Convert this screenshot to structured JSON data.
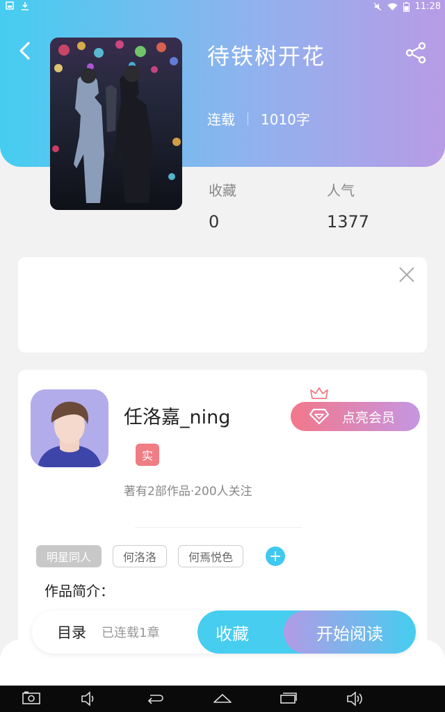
{
  "status_bar": {
    "time": "11:28"
  },
  "book": {
    "title": "待铁树开花",
    "status": "连载",
    "word_count": "1010字"
  },
  "stats": {
    "favorites_label": "收藏",
    "favorites_value": "0",
    "popularity_label": "人气",
    "popularity_value": "1377"
  },
  "author": {
    "name": "任洛嘉_ning",
    "real_badge": "实",
    "info": "著有2部作品·200人关注",
    "vip_label": "点亮会员"
  },
  "tags": [
    "明星同人",
    "何洛洛",
    "何焉悦色"
  ],
  "tag_add": "+",
  "intro_label": "作品简介：",
  "action_bar": {
    "toc_label": "目录",
    "toc_status": "已连载1章",
    "favorite_label": "收藏",
    "read_label": "开始阅读"
  },
  "icons": [
    "back-icon",
    "share-icon",
    "close-icon",
    "crown-icon",
    "diamond-icon",
    "screenshot-icon",
    "volume-down-icon",
    "back-nav-icon",
    "home-icon",
    "recents-icon",
    "volume-up-icon"
  ]
}
